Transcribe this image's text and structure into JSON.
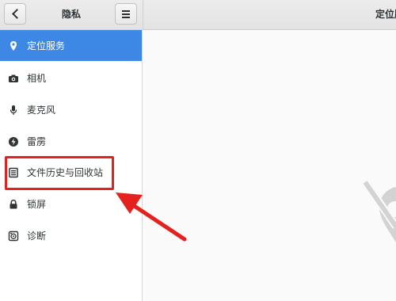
{
  "header": {
    "title": "隐私",
    "right_title": "定位服",
    "back_icon": "chevron-left-icon",
    "menu_icon": "hamburger-menu-icon"
  },
  "sidebar": {
    "items": [
      {
        "label": "定位服务",
        "icon": "location-pin-icon",
        "selected": true
      },
      {
        "label": "相机",
        "icon": "camera-icon",
        "selected": false
      },
      {
        "label": "麦克风",
        "icon": "microphone-icon",
        "selected": false
      },
      {
        "label": "雷雳",
        "icon": "thunderbolt-icon",
        "selected": false
      },
      {
        "label": "文件历史与回收站",
        "icon": "file-history-icon",
        "selected": false
      },
      {
        "label": "锁屏",
        "icon": "lock-icon",
        "selected": false
      },
      {
        "label": "诊断",
        "icon": "diagnostics-icon",
        "selected": false
      }
    ]
  },
  "content": {
    "background_icon": "location-disabled-icon"
  },
  "colors": {
    "selection": "#3d88e4",
    "annotation": "#e5211f"
  }
}
